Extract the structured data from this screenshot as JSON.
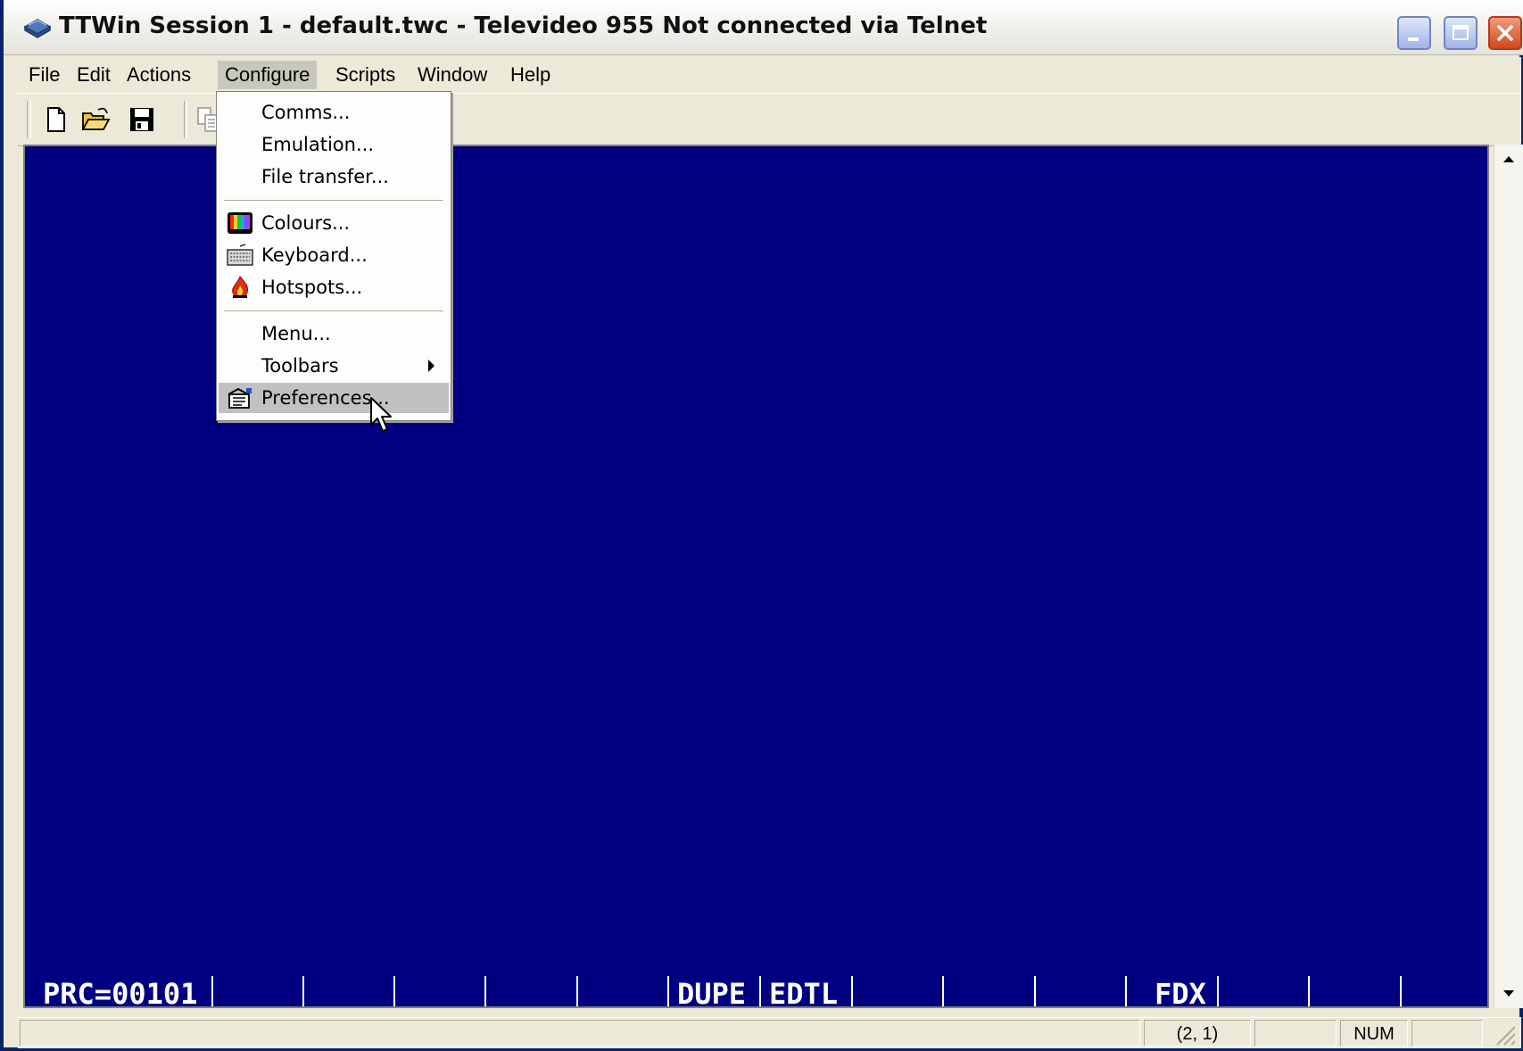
{
  "window": {
    "title": "TTWin Session 1 - default.twc - Televideo 955 Not connected via Telnet",
    "app_icon": "ttwin-app-icon"
  },
  "menubar": {
    "items": [
      {
        "label": "File"
      },
      {
        "label": "Edit"
      },
      {
        "label": "Actions"
      },
      {
        "label": "Configure",
        "active": true
      },
      {
        "label": "Scripts"
      },
      {
        "label": "Window"
      },
      {
        "label": "Help"
      }
    ]
  },
  "toolbar": {
    "buttons": [
      "new-file-icon",
      "open-folder-icon",
      "save-icon",
      "copy-icon"
    ]
  },
  "configure_menu": {
    "items": [
      {
        "label": "Comms..."
      },
      {
        "label": "Emulation..."
      },
      {
        "label": "File transfer..."
      },
      {
        "label": "Colours...",
        "icon": "colours-icon"
      },
      {
        "label": "Keyboard...",
        "icon": "keyboard-icon"
      },
      {
        "label": "Hotspots...",
        "icon": "hotspots-icon"
      },
      {
        "label": "Menu..."
      },
      {
        "label": "Toolbars",
        "submenu": true
      },
      {
        "label": "Preferences...",
        "icon": "preferences-icon",
        "highlighted": true
      }
    ]
  },
  "terminal": {
    "background": "#000080",
    "status_fields": {
      "prc": "PRC=00101",
      "dupe": "DUPE",
      "edtl": "EDTL",
      "fdx": "FDX"
    }
  },
  "statusbar": {
    "cursor_position": "(2, 1)",
    "num_lock": "NUM"
  }
}
